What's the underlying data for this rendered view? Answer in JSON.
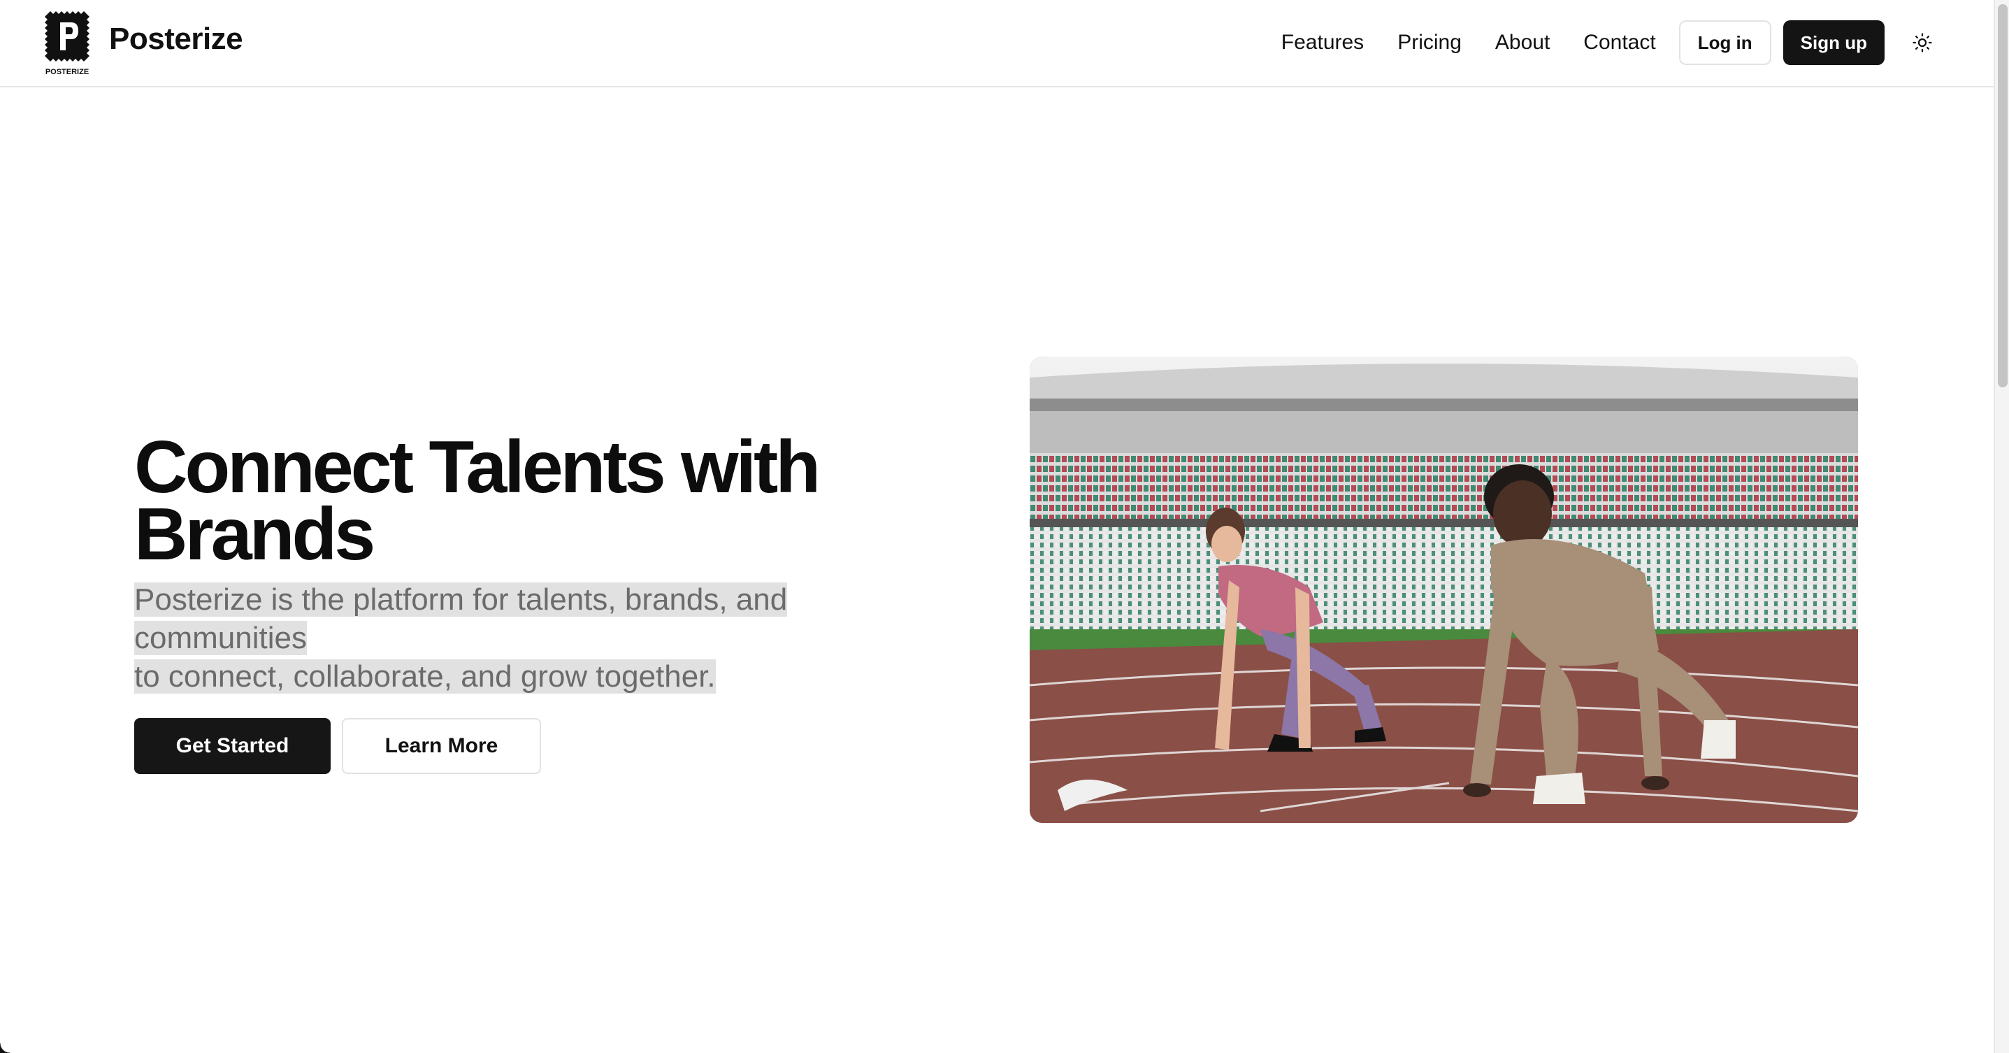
{
  "header": {
    "logo_text": "POSTERIZE",
    "brand_name": "Posterize",
    "nav": [
      "Features",
      "Pricing",
      "About",
      "Contact"
    ],
    "login_label": "Log in",
    "signup_label": "Sign up",
    "theme_icon": "sun-icon"
  },
  "hero": {
    "title": "Connect Talents with Brands",
    "subtitle_line1": "Posterize is the platform for talents, brands, and communities",
    "subtitle_line2": "to connect, collaborate, and grow together.",
    "primary_label": "Get Started",
    "secondary_label": "Learn More",
    "image_subject": "two sprinters in starting position on a stadium running track"
  },
  "colors": {
    "primary_button": "#161616",
    "subtitle_text": "#6b6b6b",
    "selection_highlight": "#e1e1e1",
    "track": "#8a4f46"
  }
}
